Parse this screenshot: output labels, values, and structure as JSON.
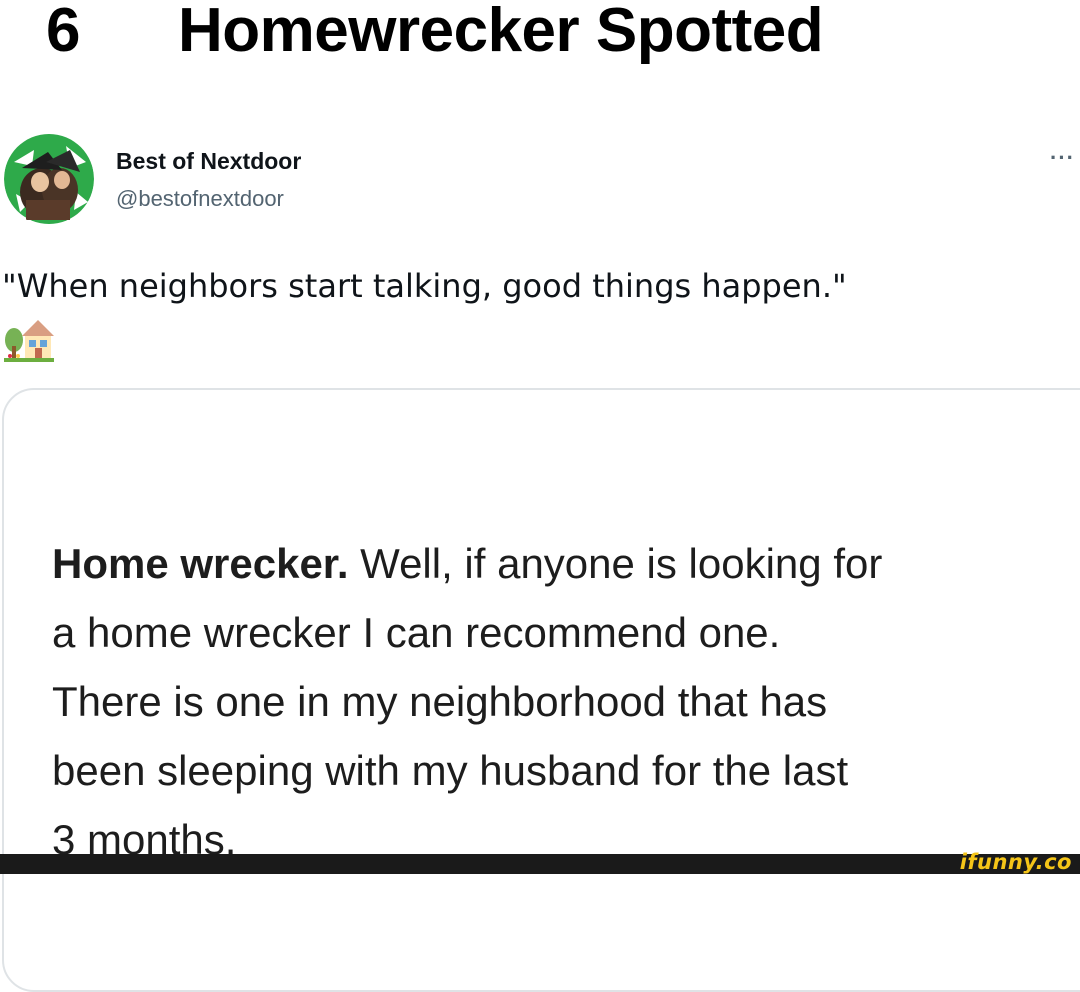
{
  "headline": {
    "number": "6",
    "title": "Homewrecker Spotted"
  },
  "tweet": {
    "author_name": "Best of Nextdoor",
    "author_handle": "@bestofnextdoor",
    "more_label": "···",
    "text": "\"When neighbors start talking, good things happen.\"",
    "emoji_icon": "house-with-garden-icon"
  },
  "card": {
    "lead": "Home wrecker.",
    "lines": [
      " Well, if anyone is looking for",
      "a home wrecker I can recommend one.",
      "There is one in my neighborhood that has",
      "been sleeping with my husband for the last",
      "3 months."
    ]
  },
  "watermark": {
    "text": "ifunny.co"
  },
  "colors": {
    "handle": "#536471",
    "card_border": "#dfe3e6",
    "avatar_bg": "#2eaa4a",
    "watermark": "#f5c518",
    "footer": "#1a1a1a"
  }
}
